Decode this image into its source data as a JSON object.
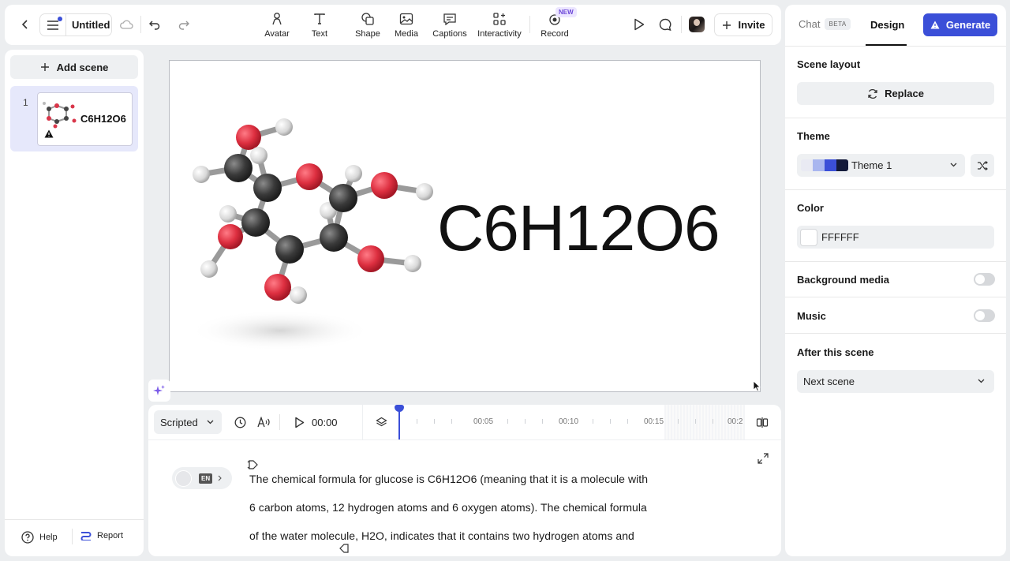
{
  "topbar": {
    "title": "Untitled",
    "tools": [
      {
        "label": "Avatar",
        "icon": "avatar-icon"
      },
      {
        "label": "Text",
        "icon": "text-icon"
      },
      {
        "label": "Shape",
        "icon": "shape-icon"
      },
      {
        "label": "Media",
        "icon": "media-icon"
      },
      {
        "label": "Captions",
        "icon": "captions-icon"
      },
      {
        "label": "Interactivity",
        "icon": "interactivity-icon"
      },
      {
        "label": "Record",
        "icon": "record-icon",
        "badge": "NEW"
      }
    ],
    "invite_label": "Invite"
  },
  "scenes": {
    "add_label": "Add scene",
    "items": [
      {
        "number": "1",
        "thumb_text": "C6H12O6"
      }
    ]
  },
  "leftfooter": {
    "help_label": "Help",
    "report_label": "Report"
  },
  "canvas": {
    "formula": "C6H12O6"
  },
  "timeline": {
    "mode": "Scripted",
    "time": "00:00",
    "marks": [
      "00:05",
      "00:10",
      "00:15",
      "00:2"
    ]
  },
  "script": {
    "lang": "EN",
    "lines": [
      "The chemical formula for glucose is C6H12O6 (meaning that it is a molecule with",
      "6 carbon atoms, 12 hydrogen atoms and 6 oxygen atoms). The chemical formula",
      "of the water molecule, H2O, indicates that it contains two hydrogen atoms and"
    ]
  },
  "right": {
    "tab_chat": "Chat",
    "tab_chat_badge": "BETA",
    "tab_design": "Design",
    "generate_label": "Generate",
    "scene_layout_title": "Scene layout",
    "replace_label": "Replace",
    "theme_title": "Theme",
    "theme_value": "Theme 1",
    "theme_swatches": [
      "#e9eaf3",
      "#a9b6ef",
      "#3b4fd8",
      "#141a3a"
    ],
    "color_title": "Color",
    "color_value": "FFFFFF",
    "background_media_label": "Background media",
    "music_label": "Music",
    "after_scene_title": "After this scene",
    "after_scene_value": "Next scene"
  },
  "colors": {
    "accent": "#3b4fd8",
    "selected_scene": "#e6e8fb"
  }
}
